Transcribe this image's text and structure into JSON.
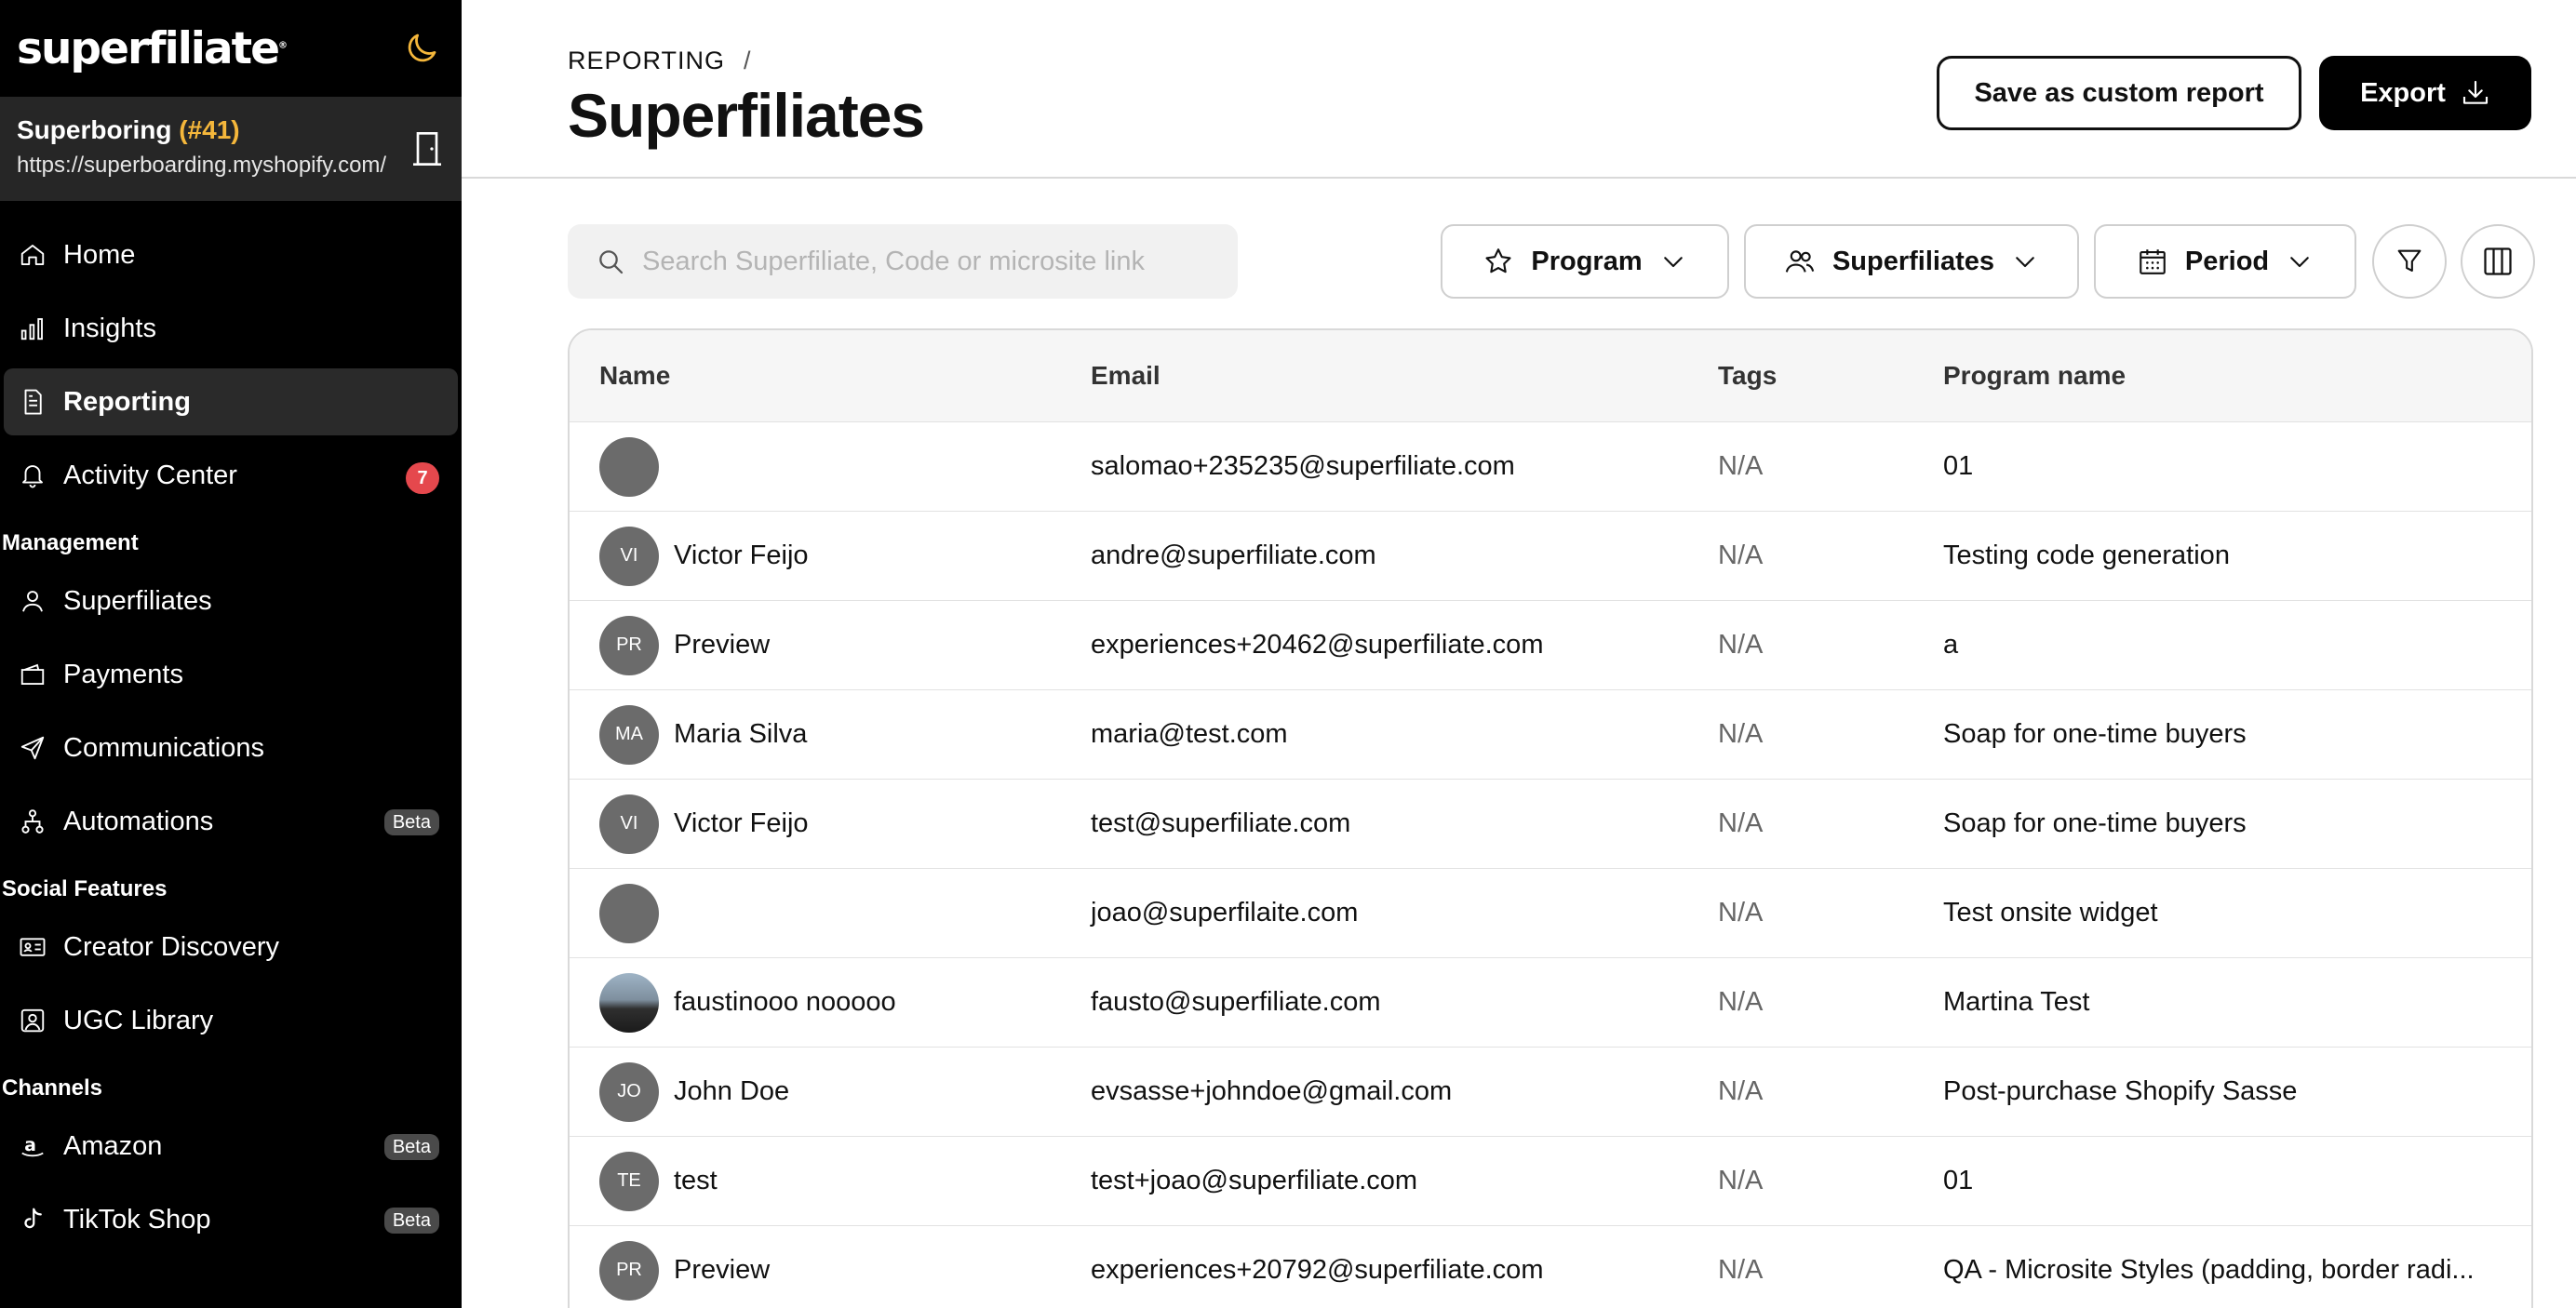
{
  "sidebar": {
    "logo": "superfiliate",
    "logo_mark": "®",
    "store": {
      "name": "Superboring",
      "number": "(#41)",
      "url": "https://superboarding.myshopify.com/"
    },
    "nav": [
      {
        "label": "Home",
        "icon": "home-icon"
      },
      {
        "label": "Insights",
        "icon": "bar-chart-icon"
      },
      {
        "label": "Reporting",
        "icon": "document-icon"
      },
      {
        "label": "Activity Center",
        "icon": "bell-icon",
        "badge": "7"
      }
    ],
    "management_label": "Management",
    "management": [
      {
        "label": "Superfiliates",
        "icon": "user-icon"
      },
      {
        "label": "Payments",
        "icon": "wallet-icon"
      },
      {
        "label": "Communications",
        "icon": "send-icon"
      },
      {
        "label": "Automations",
        "icon": "flow-icon",
        "badge": "Beta"
      }
    ],
    "social_label": "Social Features",
    "social": [
      {
        "label": "Creator Discovery",
        "icon": "id-card-icon"
      },
      {
        "label": "UGC Library",
        "icon": "portrait-icon"
      }
    ],
    "channels_label": "Channels",
    "channels": [
      {
        "label": "Amazon",
        "icon": "amazon-icon",
        "badge": "Beta"
      },
      {
        "label": "TikTok Shop",
        "icon": "tiktok-icon",
        "badge": "Beta"
      }
    ]
  },
  "header": {
    "breadcrumb": "REPORTING",
    "breadcrumb_sep": "/",
    "title": "Superfiliates",
    "save_custom_label": "Save as custom report",
    "export_label": "Export"
  },
  "toolbar": {
    "search_placeholder": "Search Superfiliate, Code or microsite link",
    "program_label": "Program",
    "superfiliates_label": "Superfiliates",
    "period_label": "Period"
  },
  "table": {
    "columns": [
      "Name",
      "Email",
      "Tags",
      "Program name"
    ],
    "rows": [
      {
        "initials": "",
        "name": "",
        "email": "salomao+235235@superfiliate.com",
        "tags": "N/A",
        "program": "01"
      },
      {
        "initials": "VI",
        "name": "Victor Feijo",
        "email": "andre@superfiliate.com",
        "tags": "N/A",
        "program": "Testing code generation"
      },
      {
        "initials": "PR",
        "name": "Preview",
        "email": "experiences+20462@superfiliate.com",
        "tags": "N/A",
        "program": "a"
      },
      {
        "initials": "MA",
        "name": "Maria Silva",
        "email": "maria@test.com",
        "tags": "N/A",
        "program": "Soap for one-time buyers"
      },
      {
        "initials": "VI",
        "name": "Victor Feijo",
        "email": "test@superfiliate.com",
        "tags": "N/A",
        "program": "Soap for one-time buyers"
      },
      {
        "initials": "",
        "name": "",
        "email": "joao@superfilaite.com",
        "tags": "N/A",
        "program": "Test onsite widget"
      },
      {
        "initials": "",
        "name": "faustinooo nooooo",
        "email": "fausto@superfiliate.com",
        "tags": "N/A",
        "program": "Martina Test",
        "photo": true
      },
      {
        "initials": "JO",
        "name": "John Doe",
        "email": "evsasse+johndoe@gmail.com",
        "tags": "N/A",
        "program": "Post-purchase Shopify Sasse"
      },
      {
        "initials": "TE",
        "name": "test",
        "email": "test+joao@superfiliate.com",
        "tags": "N/A",
        "program": "01"
      },
      {
        "initials": "PR",
        "name": "Preview",
        "email": "experiences+20792@superfiliate.com",
        "tags": "N/A",
        "program": "QA - Microsite Styles (padding, border radi..."
      }
    ]
  },
  "colors": {
    "accent_store_number": "#f5b73b",
    "badge_red": "#e5484d",
    "sidebar_bg": "#000000"
  }
}
